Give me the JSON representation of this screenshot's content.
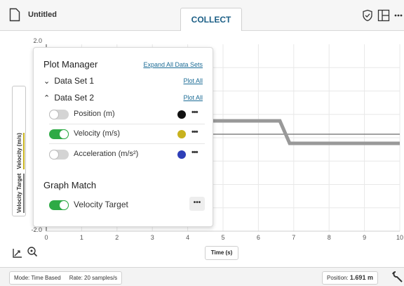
{
  "header": {
    "title": "Untitled",
    "collect_label": "COLLECT",
    "icons": [
      "file-icon",
      "shield-check-icon",
      "layout-grid-icon",
      "more-icon"
    ]
  },
  "graph": {
    "y_axis": {
      "max_label": "2.0",
      "min_label": "-2.0"
    },
    "x_axis": {
      "title": "Time (s)",
      "ticks": [
        "0",
        "1",
        "2",
        "3",
        "4",
        "5",
        "6",
        "7",
        "8",
        "9",
        "10"
      ]
    },
    "y_legend": {
      "target": "Velocity Target",
      "velocity": "Velocity (m/s)"
    },
    "colors": {
      "target_line": "#999999",
      "velocity_line": "#c8b21e",
      "grid": "#e8e8e8",
      "cursor_line": "#6b6b6b"
    }
  },
  "plot_manager": {
    "title": "Plot Manager",
    "expand_all": "Expand All Data Sets",
    "data_sets": [
      {
        "label": "Data Set 1",
        "expanded": false,
        "plot_all": "Plot All"
      },
      {
        "label": "Data Set 2",
        "expanded": true,
        "plot_all": "Plot All"
      }
    ],
    "series": [
      {
        "label": "Position (m)",
        "on": false,
        "color": "#111111"
      },
      {
        "label": "Velocity (m/s)",
        "on": true,
        "color": "#c8b21e"
      },
      {
        "label": "Acceleration (m/s²)",
        "on": false,
        "color": "#2e3fb8"
      }
    ],
    "graph_match": {
      "title": "Graph Match",
      "label": "Velocity Target",
      "on": true
    }
  },
  "status": {
    "mode": "Mode: Time Based",
    "rate": "Rate: 20 samples/s",
    "position_label": "Position:",
    "position_value": "1.691 m"
  }
}
